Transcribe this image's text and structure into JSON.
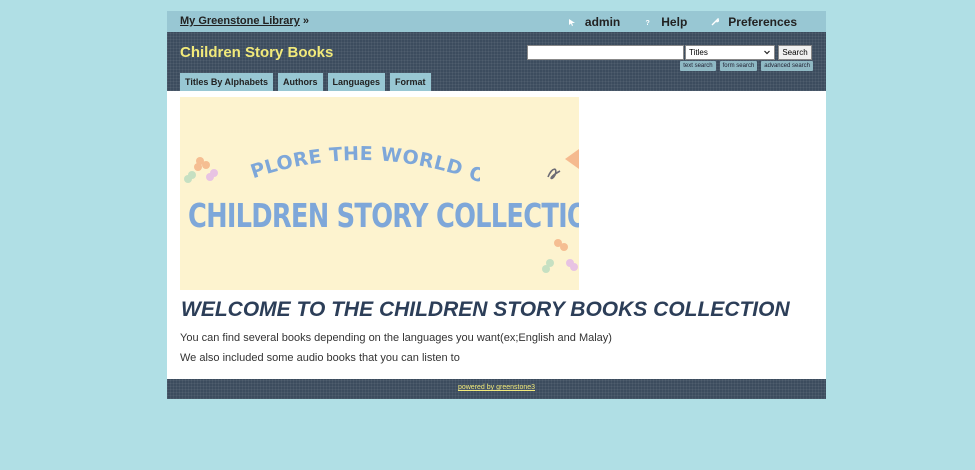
{
  "topbar": {
    "home_label": "My Greenstone Library",
    "home_suffix": " »",
    "links": [
      {
        "label": "admin",
        "icon": "user-icon"
      },
      {
        "label": "Help",
        "icon": "help-icon"
      },
      {
        "label": "Preferences",
        "icon": "wrench-icon"
      }
    ]
  },
  "header": {
    "collection_title": "Children Story Books",
    "search": {
      "input_value": "",
      "select_value": "Titles",
      "button_label": "Search",
      "links": [
        "text search",
        "form search",
        "advanced search"
      ]
    },
    "tabs": [
      "Titles By Alphabets",
      "Authors",
      "Languages",
      "Format"
    ]
  },
  "content": {
    "banner_subtitle": "EXPLORE THE WORLD OF",
    "banner_title": "CHILDREN STORY COLLECTION",
    "welcome_heading": "WELCOME TO THE CHILDREN STORY BOOKS COLLECTION",
    "paragraph_1": "You can find several books depending on the languages you want(ex;English and Malay)",
    "paragraph_2": "We also included some audio books that you can listen to"
  },
  "footer": {
    "powered_by": "powered by greenstone3"
  },
  "colors": {
    "background": "#b0dfe5",
    "topbar": "#98c7d3",
    "header": "#3c4c5e",
    "title_yellow": "#f2ea7a",
    "heading": "#2c3e58",
    "banner_bg": "#fdf3cf",
    "banner_text": "#7ea7d9"
  }
}
